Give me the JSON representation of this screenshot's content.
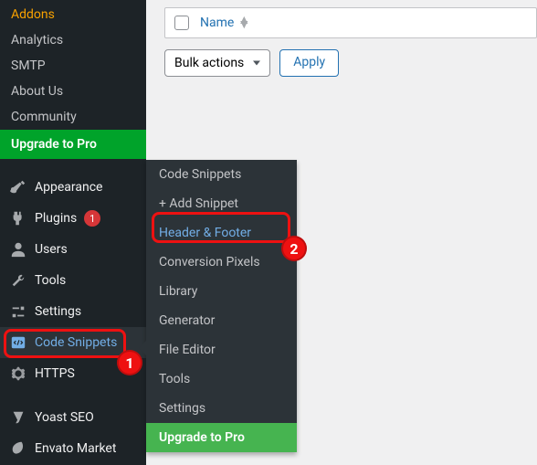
{
  "sidebar": {
    "sub_items": [
      {
        "label": "Addons",
        "active": true
      },
      {
        "label": "Analytics",
        "active": false
      },
      {
        "label": "SMTP",
        "active": false
      },
      {
        "label": "About Us",
        "active": false
      },
      {
        "label": "Community",
        "active": false
      }
    ],
    "upgrade_label": "Upgrade to Pro",
    "main_items": [
      {
        "label": "Appearance",
        "icon": "brush-icon"
      },
      {
        "label": "Plugins",
        "icon": "plug-icon",
        "badge": "1"
      },
      {
        "label": "Users",
        "icon": "user-icon"
      },
      {
        "label": "Tools",
        "icon": "wrench-icon"
      },
      {
        "label": "Settings",
        "icon": "sliders-icon"
      },
      {
        "label": "Code Snippets",
        "icon": "code-icon",
        "current": true
      },
      {
        "label": "HTTPS",
        "icon": "gear-icon"
      },
      {
        "label": "Yoast SEO",
        "icon": "yoast-icon",
        "gap": true
      },
      {
        "label": "Envato Market",
        "icon": "leaf-icon"
      }
    ]
  },
  "submenu": {
    "items": [
      "Code Snippets",
      "+ Add Snippet",
      "Header & Footer",
      "Conversion Pixels",
      "Library",
      "Generator",
      "File Editor",
      "Tools",
      "Settings"
    ],
    "highlight_index": 2,
    "upgrade_label": "Upgrade to Pro"
  },
  "annotations": {
    "one": "1",
    "two": "2"
  },
  "table": {
    "name_col": "Name"
  },
  "bulk": {
    "select": "Bulk actions",
    "apply": "Apply"
  }
}
